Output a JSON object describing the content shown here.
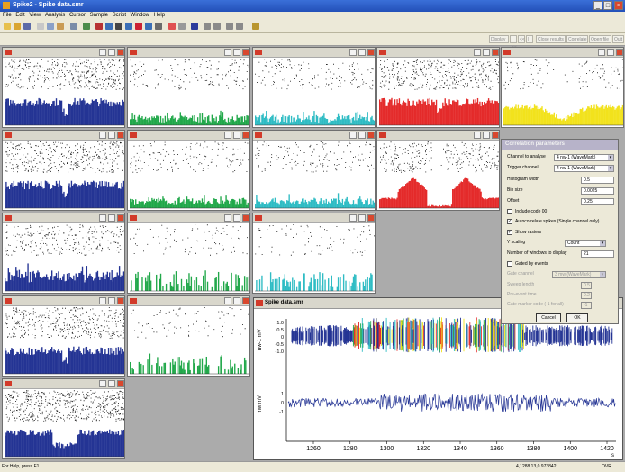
{
  "app": {
    "title": "Spike2 - Spike data.smr"
  },
  "menu": [
    "File",
    "Edit",
    "View",
    "Analysis",
    "Cursor",
    "Sample",
    "Script",
    "Window",
    "Help"
  ],
  "toolbar2": [
    "Display",
    "|<<",
    "<<",
    "|",
    "Close results",
    "Correlate",
    "Open file",
    "Quit"
  ],
  "mini_windows": [
    {
      "name": "corr-window-1-1",
      "color": "#243494",
      "kind": "full"
    },
    {
      "name": "corr-window-1-2",
      "color": "#21a84a",
      "kind": "low"
    },
    {
      "name": "corr-window-1-3",
      "color": "#2fbcc4",
      "kind": "low"
    },
    {
      "name": "corr-window-1-4",
      "color": "#e42b2b",
      "kind": "full"
    },
    {
      "name": "corr-window-1-5",
      "color": "#f2e21c",
      "kind": "dip"
    },
    {
      "name": "corr-window-2-1",
      "color": "#243494",
      "kind": "full"
    },
    {
      "name": "corr-window-2-2",
      "color": "#21a84a",
      "kind": "low"
    },
    {
      "name": "corr-window-2-3",
      "color": "#2fbcc4",
      "kind": "low"
    },
    {
      "name": "corr-window-2-4",
      "color": "#e42b2b",
      "kind": "hump"
    },
    {
      "name": "corr-window-3-1",
      "color": "#243494",
      "kind": "mid"
    },
    {
      "name": "corr-window-3-2",
      "color": "#21a84a",
      "kind": "sparse"
    },
    {
      "name": "corr-window-3-3",
      "color": "#2fbcc4",
      "kind": "sparse"
    },
    {
      "name": "corr-window-4-1",
      "color": "#243494",
      "kind": "full"
    },
    {
      "name": "corr-window-4-2",
      "color": "#21a84a",
      "kind": "sparse"
    },
    {
      "name": "corr-window-5-1",
      "color": "#243494",
      "kind": "dense"
    }
  ],
  "data_window": {
    "title": "Spike data.smr",
    "ch1_label": "nw-1 mV",
    "ch2_label": "mw mV",
    "ch1_ticks": [
      "1.0",
      "0.5",
      "0",
      "-0.5",
      "-1.0"
    ],
    "ch2_ticks": [
      "1",
      "0",
      "-1"
    ],
    "x_ticks": [
      "1260",
      "1280",
      "1300",
      "1320",
      "1340",
      "1360",
      "1380",
      "1400",
      "1420"
    ],
    "x_unit": "s"
  },
  "dialog": {
    "title": "Correlation parameters",
    "channel_label": "Channel to analyse",
    "channel_value": "4 nw-1 (WaveMark)",
    "trigger_label": "Trigger channel",
    "trigger_value": "4 nw-1 (WaveMark)",
    "hist_width_label": "Histogram width",
    "hist_width_value": "0.5",
    "bin_size_label": "Bin size",
    "bin_size_value": "0.0025",
    "offset_label": "Offset",
    "offset_value": "0.25",
    "include_code00": "Include code 00",
    "autocorrelate": "Autocorrelate spikes (Single channel only)",
    "show_rasters": "Show rasters",
    "y_scaling_label": "Y scaling",
    "y_scaling_value": "Count",
    "num_windows_label": "Number of windows to display",
    "num_windows_value": "21",
    "gated": "Gated by events",
    "gate_channel_label": "Gate channel",
    "gate_channel_value": "3 mw (WaveMark)",
    "sweep_length_label": "Sweep length",
    "sweep_length_value": "0.5",
    "pre_event_label": "Pre-event time",
    "pre_event_value": "0.2",
    "gate_marker_label": "Gate marker code (-1 for all)",
    "gate_marker_value": "-1",
    "cancel": "Cancel",
    "ok": "OK"
  },
  "status": {
    "help": "For Help, press F1",
    "coords": "4,1288.13,0.973842",
    "ovr": "OVR"
  }
}
